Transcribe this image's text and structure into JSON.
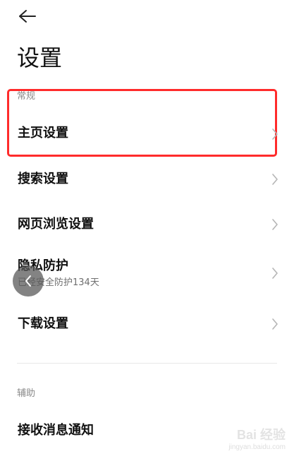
{
  "header": {
    "title": "设置"
  },
  "sections": {
    "general": "常规",
    "assist": "辅助"
  },
  "items": [
    {
      "label": "主页设置"
    },
    {
      "label": "搜索设置"
    },
    {
      "label": "网页浏览设置"
    },
    {
      "label": "隐私防护",
      "sub": "已经安全防护134天"
    },
    {
      "label": "下载设置"
    },
    {
      "label": "接收消息通知"
    }
  ],
  "watermark": {
    "main": "Bai 经验",
    "sub": "jingyan.baidu.com"
  },
  "colors": {
    "highlight": "#ff2b2b",
    "text": "#111111",
    "muted": "#8a8a8a"
  }
}
